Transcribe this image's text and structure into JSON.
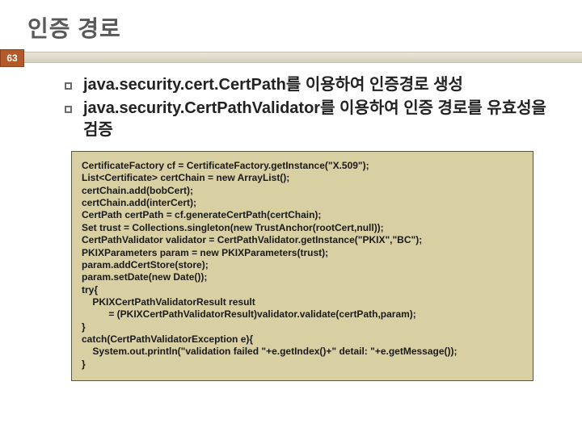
{
  "slide": {
    "title": "인증 경로",
    "number": "63",
    "bullets": [
      "java.security.cert.CertPath를 이용하여 인증경로 생성",
      "java.security.CertPathValidator를 이용하여 인증 경로를 유효성을 검증"
    ],
    "code": "CertificateFactory cf = CertificateFactory.getInstance(\"X.509\");\nList<Certificate> certChain = new ArrayList();\ncertChain.add(bobCert);\ncertChain.add(interCert);\nCertPath certPath = cf.generateCertPath(certChain);\nSet trust = Collections.singleton(new TrustAnchor(rootCert,null));\nCertPathValidator validator = CertPathValidator.getInstance(\"PKIX\",\"BC\");\nPKIXParameters param = new PKIXParameters(trust);\nparam.addCertStore(store);\nparam.setDate(new Date());\ntry{\n    PKIXCertPathValidatorResult result\n          = (PKIXCertPathValidatorResult)validator.validate(certPath,param);\n}\ncatch(CertPathValidatorException e){\n    System.out.println(\"validation failed \"+e.getIndex()+\" detail: \"+e.getMessage());\n}"
  }
}
